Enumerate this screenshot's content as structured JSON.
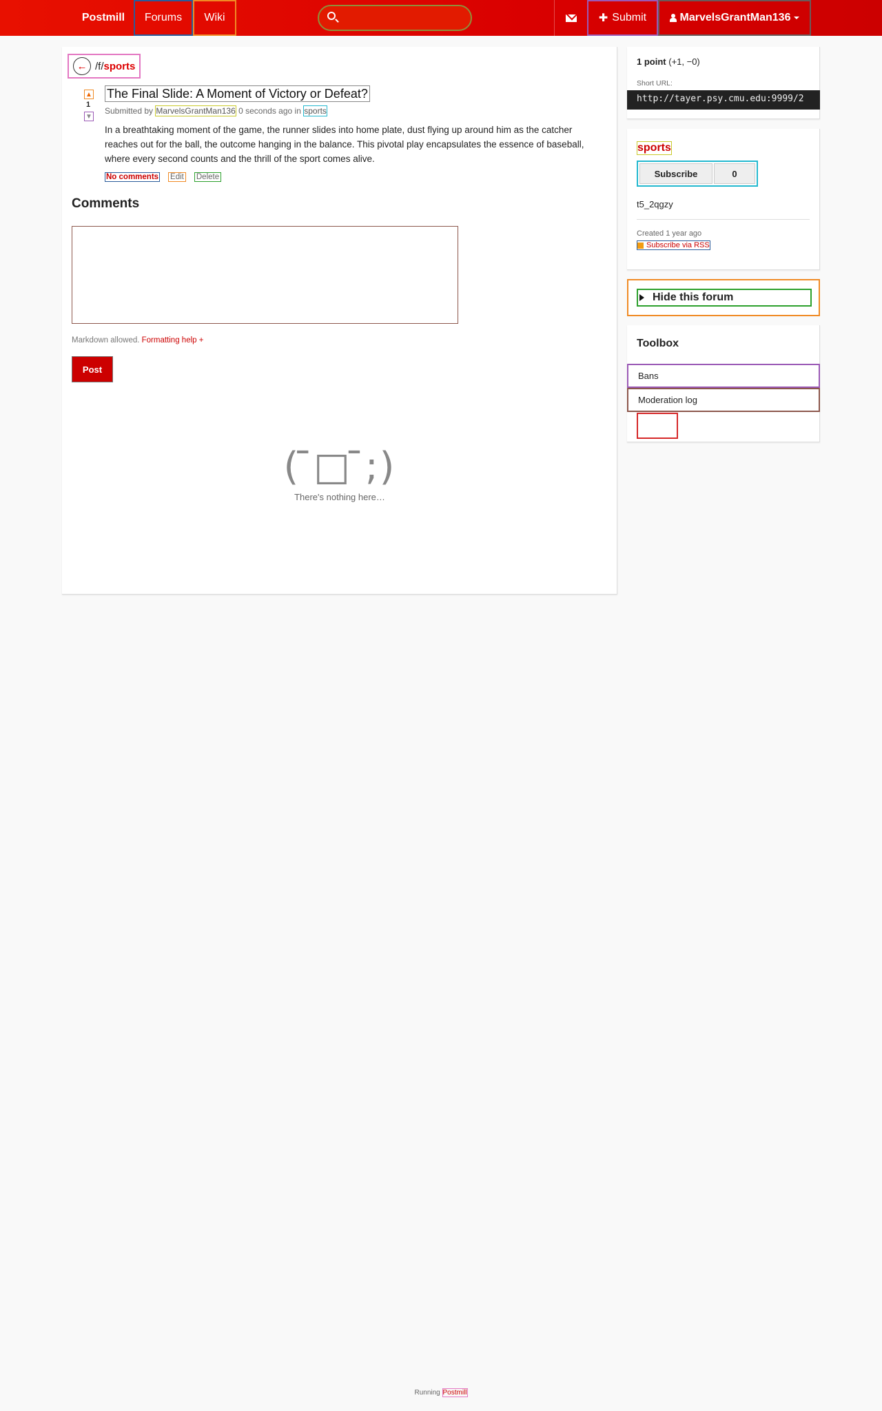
{
  "header": {
    "brand": "Postmill",
    "nav": {
      "forums": "Forums",
      "wiki": "Wiki"
    },
    "search": {
      "placeholder": ""
    },
    "submit_label": "Submit",
    "username": "MarvelsGrantMan136"
  },
  "breadcrumb": {
    "prefix": "/f/",
    "forum": "sports"
  },
  "post": {
    "score": "1",
    "title": "The Final Slide: A Moment of Victory or Defeat?",
    "submitted_prefix": "Submitted by",
    "author": "MarvelsGrantMan136",
    "time": "0 seconds ago",
    "in_label": "in",
    "forum": "sports",
    "body": "In a breathtaking moment of the game, the runner slides into home plate, dust flying up around him as the catcher reaches out for the ball, the outcome hanging in the balance. This pivotal play encapsulates the essence of baseball, where every second counts and the thrill of the sport comes alive.",
    "actions": {
      "comments": "No comments",
      "edit": "Edit",
      "delete": "Delete"
    }
  },
  "comments": {
    "heading": "Comments",
    "markdown_note": "Markdown allowed.",
    "formatting_help": "Formatting help +",
    "post_button": "Post",
    "empty_face": "( ̄□ ̄;)",
    "empty_text": "There's nothing here…"
  },
  "sidebar": {
    "score_card": {
      "points": "1 point",
      "breakdown": "(+1, −0)",
      "short_url_label": "Short URL:",
      "short_url": "http://tayer.psy.cmu.edu:9999/2"
    },
    "forum_card": {
      "name": "sports",
      "subscribe_label": "Subscribe",
      "subscriber_count": "0",
      "forum_id": "t5_2qgzy",
      "created": "Created 1 year ago",
      "rss": "Subscribe via RSS"
    },
    "hide_forum": "Hide this forum",
    "toolbox": {
      "title": "Toolbox",
      "bans": "Bans",
      "moderation_log": "Moderation log"
    }
  },
  "footer": {
    "running": "Running",
    "link": "Postmill"
  },
  "colors": {
    "accent": "#cc0000",
    "header_bg": "#e81000"
  }
}
